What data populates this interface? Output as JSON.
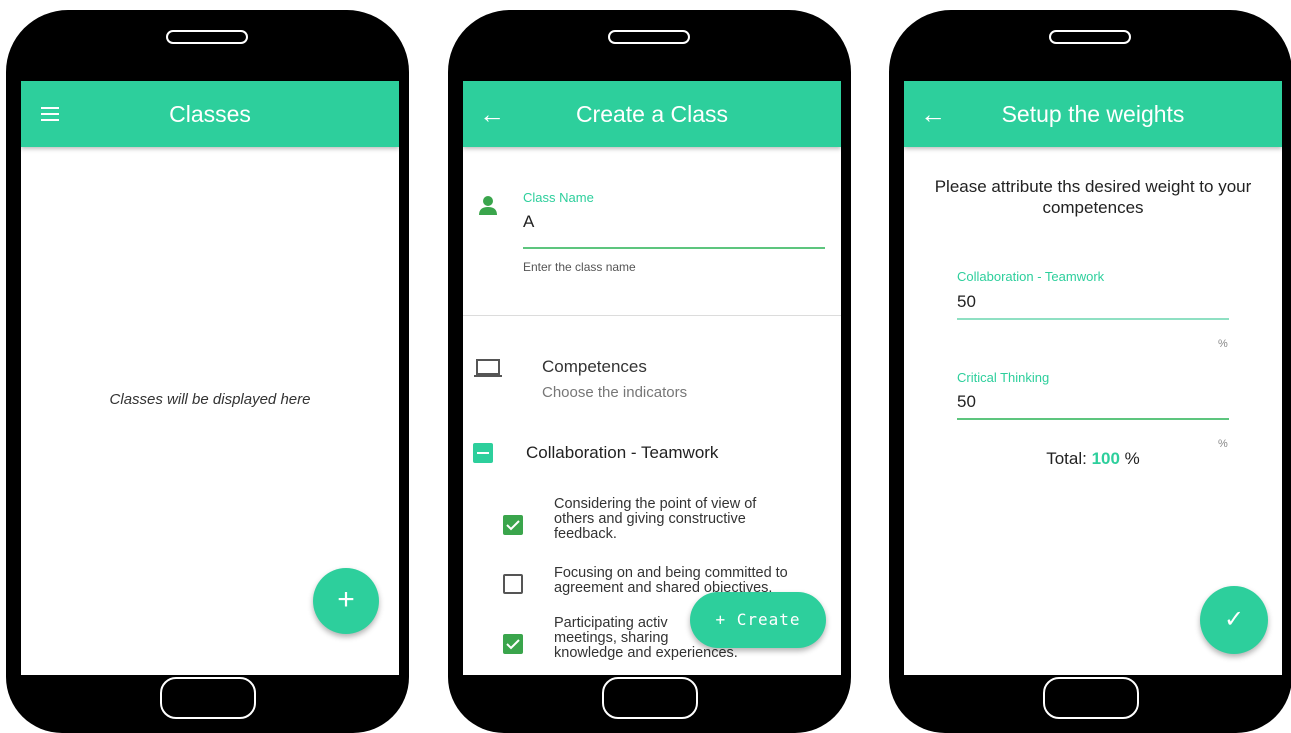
{
  "screen1": {
    "title": "Classes",
    "menu_icon": "hamburger-menu-icon",
    "empty_message": "Classes will be displayed here",
    "fab_icon": "+"
  },
  "screen2": {
    "title": "Create a Class",
    "back_icon": "←",
    "class_name": {
      "label": "Class Name",
      "value": "A",
      "helper": "Enter the class name",
      "icon": "person-icon"
    },
    "competences": {
      "title": "Competences",
      "subtitle": "Choose the indicators",
      "icon": "laptop-icon"
    },
    "group": {
      "label": "Collaboration - Teamwork",
      "state": "indeterminate"
    },
    "items": [
      {
        "checked": true,
        "lines": [
          "Considering the point of view of",
          "others and giving constructive",
          "feedback."
        ]
      },
      {
        "checked": false,
        "lines": [
          "Focusing on and being committed to",
          "agreement and shared objectives."
        ]
      },
      {
        "checked": true,
        "lines": [
          "Participating activ",
          "meetings, sharing",
          "knowledge and experiences."
        ]
      }
    ],
    "create_button": "+ Create"
  },
  "screen3": {
    "title": "Setup the weights",
    "back_icon": "←",
    "instruction": "Please attribute ths desired weight to your competences",
    "fields": [
      {
        "label": "Collaboration - Teamwork",
        "value": "50",
        "suffix": "%"
      },
      {
        "label": "Critical Thinking",
        "value": "50",
        "suffix": "%"
      }
    ],
    "total_label": "Total:",
    "total_value": "100",
    "total_unit": "%",
    "fab_icon": "✓"
  },
  "colors": {
    "primary": "#2dcf9c",
    "accent_green": "#3aa54c",
    "phone_frame": "#000000"
  }
}
